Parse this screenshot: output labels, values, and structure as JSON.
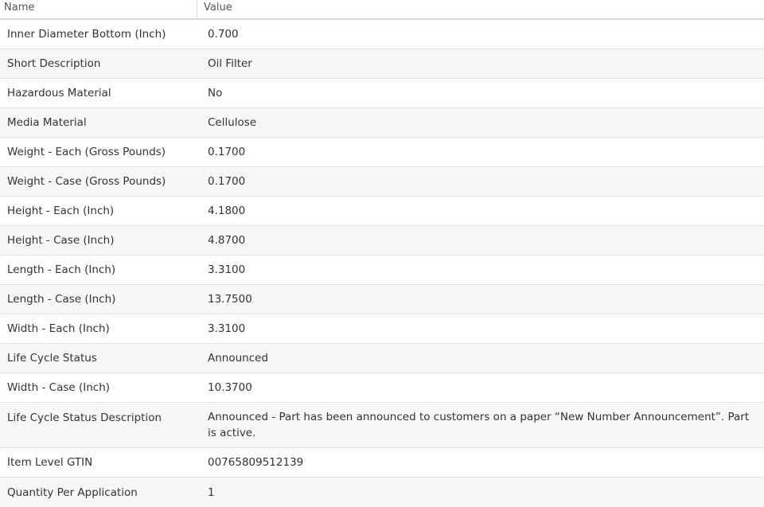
{
  "table": {
    "columns": [
      "Name",
      "Value"
    ],
    "rows": [
      {
        "name": "Inner Diameter Bottom (Inch)",
        "value": "0.700"
      },
      {
        "name": "Short Description",
        "value": "Oil Filter"
      },
      {
        "name": "Hazardous Material",
        "value": "No"
      },
      {
        "name": "Media Material",
        "value": "Cellulose"
      },
      {
        "name": "Weight - Each (Gross Pounds)",
        "value": "0.1700"
      },
      {
        "name": "Weight - Case (Gross Pounds)",
        "value": "0.1700"
      },
      {
        "name": "Height - Each (Inch)",
        "value": "4.1800"
      },
      {
        "name": "Height - Case (Inch)",
        "value": "4.8700"
      },
      {
        "name": "Length - Each (Inch)",
        "value": "3.3100"
      },
      {
        "name": "Length - Case (Inch)",
        "value": "13.7500"
      },
      {
        "name": "Width - Each (Inch)",
        "value": "3.3100"
      },
      {
        "name": "Life Cycle Status",
        "value": "Announced"
      },
      {
        "name": "Width - Case (Inch)",
        "value": "10.3700"
      },
      {
        "name": "Life Cycle Status Description",
        "value": "Announced - Part has been announced to customers on a paper “New Number Announcement”. Part is active."
      },
      {
        "name": "Item Level GTIN",
        "value": "00765809512139"
      },
      {
        "name": "Quantity Per Application",
        "value": "1"
      }
    ]
  }
}
